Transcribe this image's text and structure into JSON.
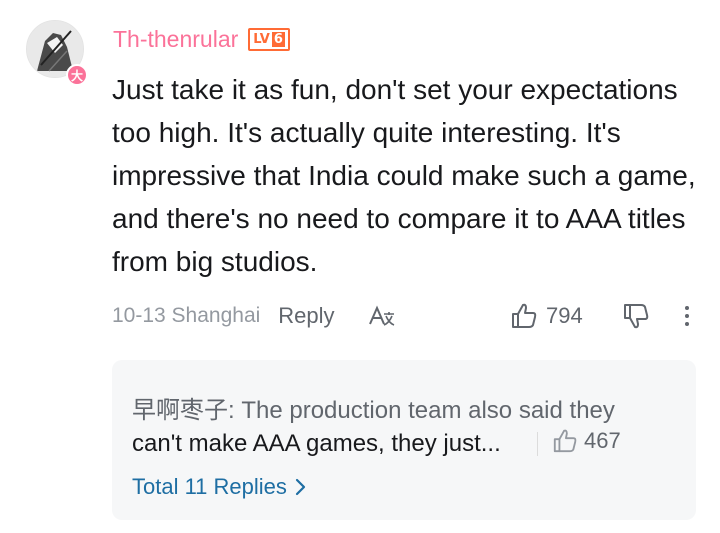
{
  "comment": {
    "username": "Th-thenrular",
    "level_prefix": "LV",
    "level": "6",
    "avatar_badge": "大",
    "text": "Just take it as fun, don't set your expectations too high. It's actually quite interesting. It's impressive that India could make such a game, and there's no need to compare it to AAA titles from big studios.",
    "time_location": "10-13 Shanghai",
    "reply_label": "Reply",
    "translate_icon": "A文",
    "like_count": "794"
  },
  "reply_preview": {
    "author": "早啊枣子",
    "line1_text": ": The production team also said they",
    "line2_text": "can't make AAA games, they just...",
    "like_count": "467",
    "total_replies_label": "Total 11 Replies"
  },
  "colors": {
    "username": "#fb7299",
    "level_badge": "#ff6b35",
    "link_blue": "#1e6ea3",
    "muted": "#9499a0"
  },
  "icons": [
    "thumbs-up-icon",
    "thumbs-down-icon",
    "more-icon",
    "translate-icon",
    "chevron-right-icon"
  ]
}
